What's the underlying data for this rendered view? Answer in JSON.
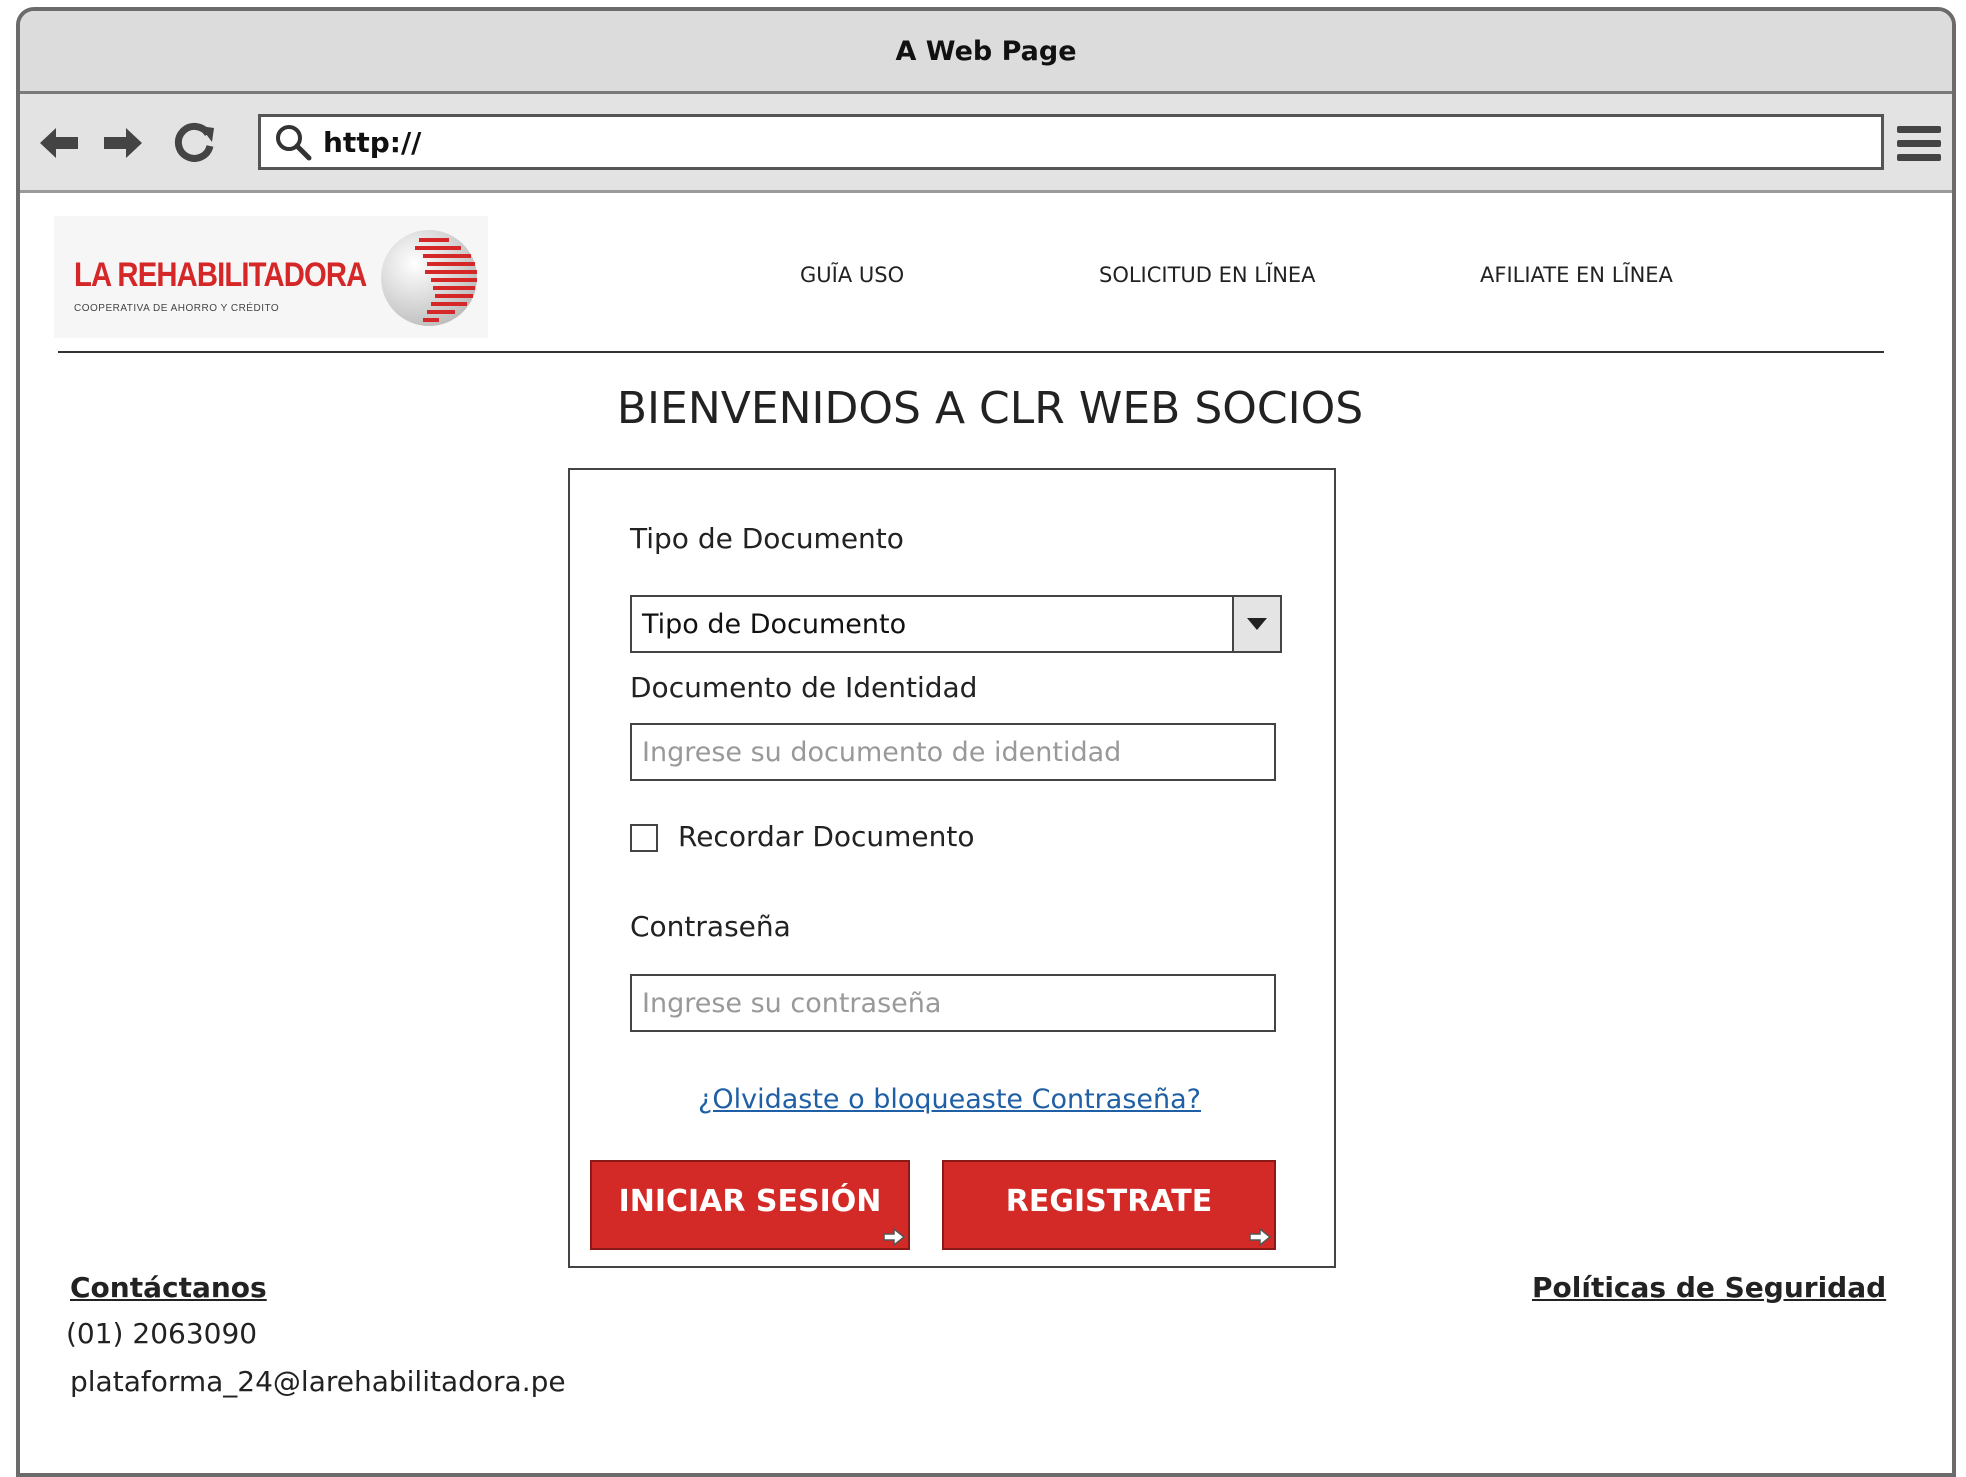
{
  "window": {
    "title": "A Web Page"
  },
  "browser": {
    "url": "http://"
  },
  "header": {
    "logo_name": "LA REHABILITADORA",
    "logo_subtitle": "COOPERATIVA DE AHORRO Y CRÉDITO",
    "nav": [
      "GUĨA USO",
      "SOLICITUD EN LĨNEA",
      "AFILIATE EN LĨNEA"
    ]
  },
  "main": {
    "title": "BIENVENIDOS A CLR WEB SOCIOS",
    "form": {
      "doc_type_label": "Tipo de Documento",
      "doc_type_value": "Tipo de Documento",
      "doc_id_label": "Documento de Identidad",
      "doc_id_placeholder": "Ingrese su documento de identidad",
      "remember_label": "Recordar Documento",
      "password_label": "Contraseña",
      "password_placeholder": "Ingrese su contraseña",
      "forgot_link": "¿Olvidaste o bloqueaste Contraseña?",
      "login_button": "INICIAR SESIÓN",
      "register_button": "REGISTRATE"
    }
  },
  "footer": {
    "contact_title": "Contáctanos",
    "phone": "(01) 2063090",
    "email": "plataforma_24@larehabilitadora.pe",
    "security_link": "Políticas de Seguridad"
  },
  "colors": {
    "accent": "#d32a27",
    "link": "#1f5fa6"
  }
}
